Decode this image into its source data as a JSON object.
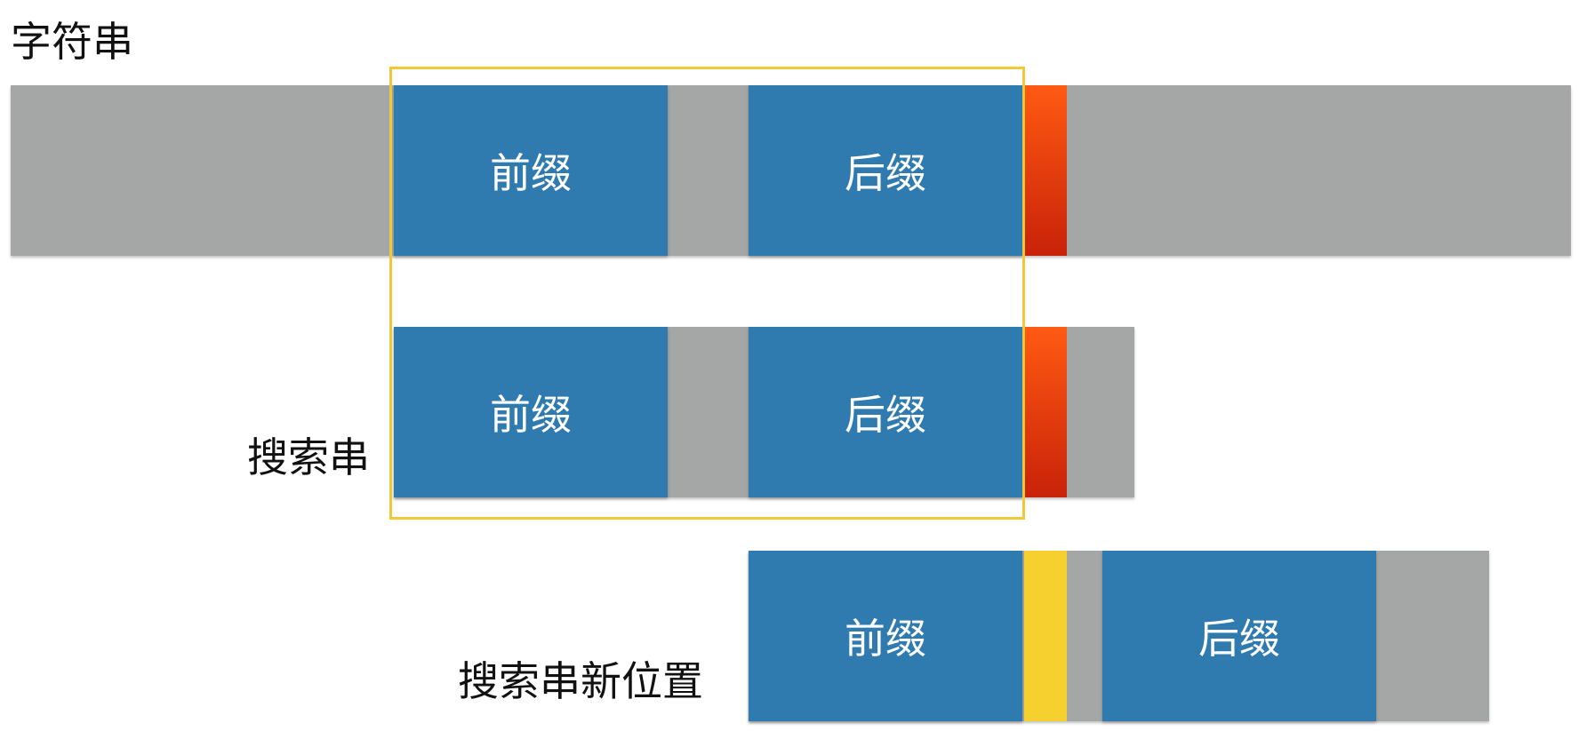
{
  "labels": {
    "string": "字符串",
    "search": "搜索串",
    "search_new": "搜索串新位置"
  },
  "blocks": {
    "prefix": "前缀",
    "suffix": "后缀"
  },
  "colors": {
    "gray_bar": "#a5a7a6",
    "blue_block": "#2f7bb0",
    "red_marker": "#e0360e",
    "yellow_marker": "#f5d02e",
    "frame": "#f0c935"
  }
}
